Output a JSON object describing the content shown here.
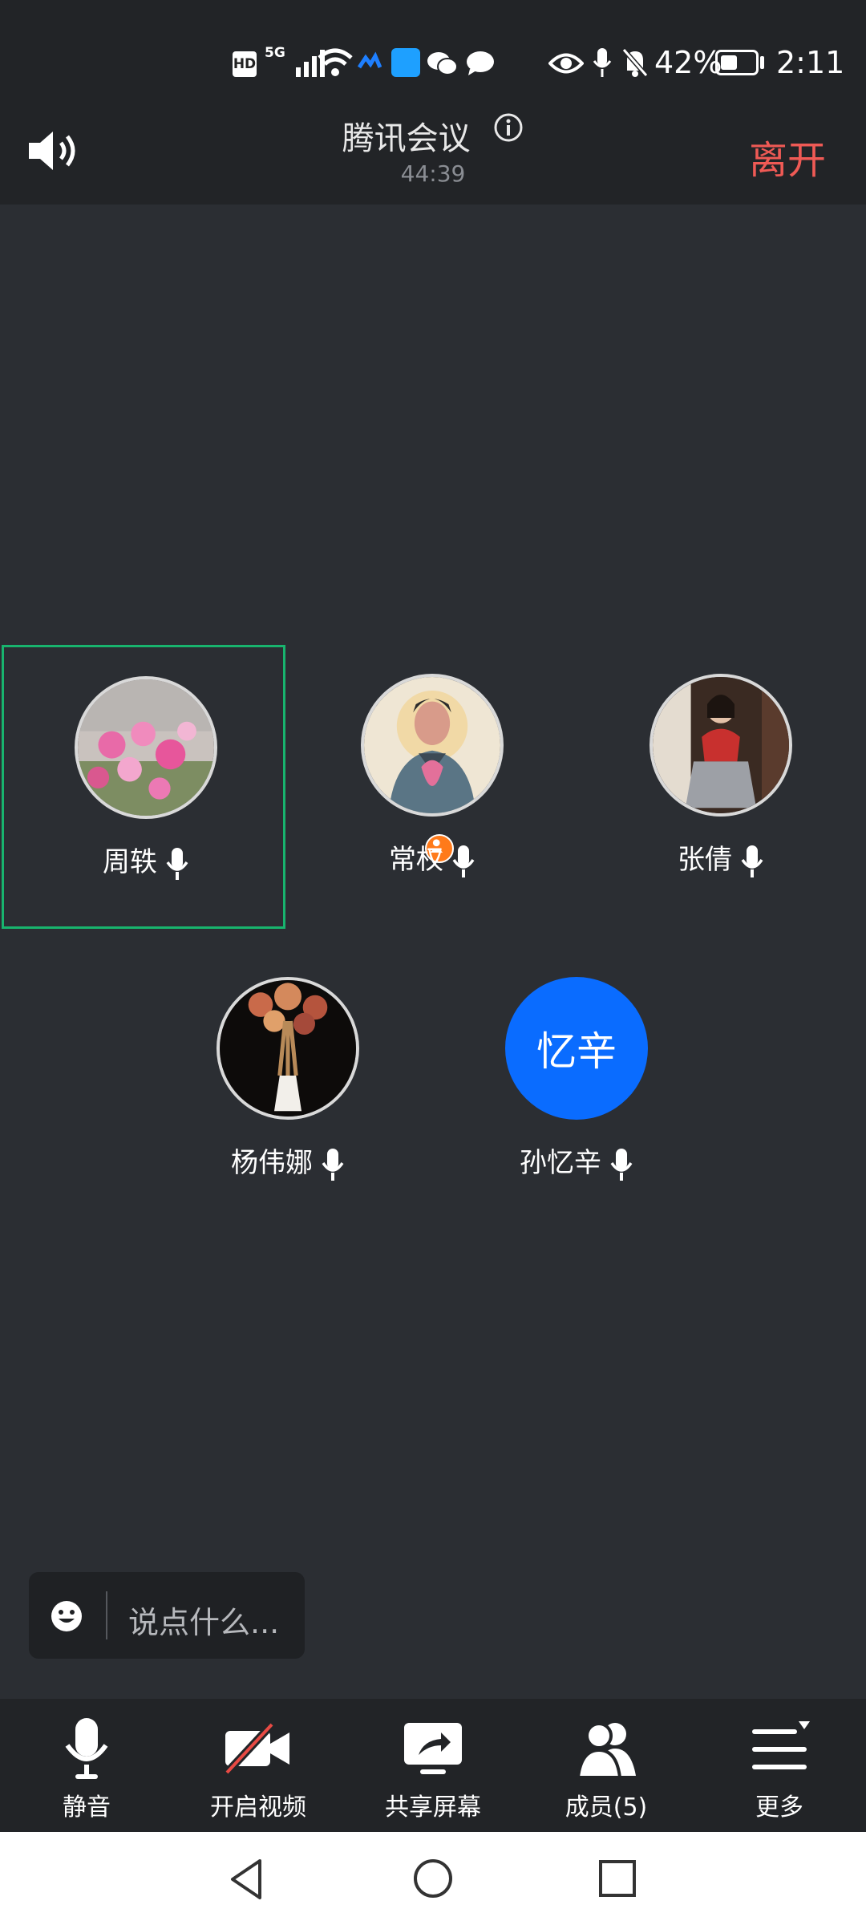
{
  "status_bar": {
    "badges": [
      "HD",
      "5G"
    ],
    "battery": "42%",
    "time": "2:11"
  },
  "header": {
    "title": "腾讯会议",
    "duration": "44:39",
    "leave_label": "离开"
  },
  "participants": [
    {
      "name": "周轶",
      "avatar": "flowers-photo",
      "active": true
    },
    {
      "name": "常权",
      "avatar": "illustrated-portrait",
      "host_badge": true
    },
    {
      "name": "张倩",
      "avatar": "seated-woman-photo"
    },
    {
      "name": "杨伟娜",
      "avatar": "dried-flowers-vase-photo"
    },
    {
      "name": "孙忆辛",
      "avatar_text": "忆辛",
      "avatar_color": "#0a6cff"
    }
  ],
  "chat": {
    "placeholder": "说点什么..."
  },
  "toolbar": {
    "mute": "静音",
    "video": "开启视频",
    "share": "共享屏幕",
    "members": "成员(5)",
    "more": "更多"
  },
  "colors": {
    "leave": "#ef5a55",
    "active_border": "#18b46e",
    "avatar_blue": "#0a6cff"
  }
}
